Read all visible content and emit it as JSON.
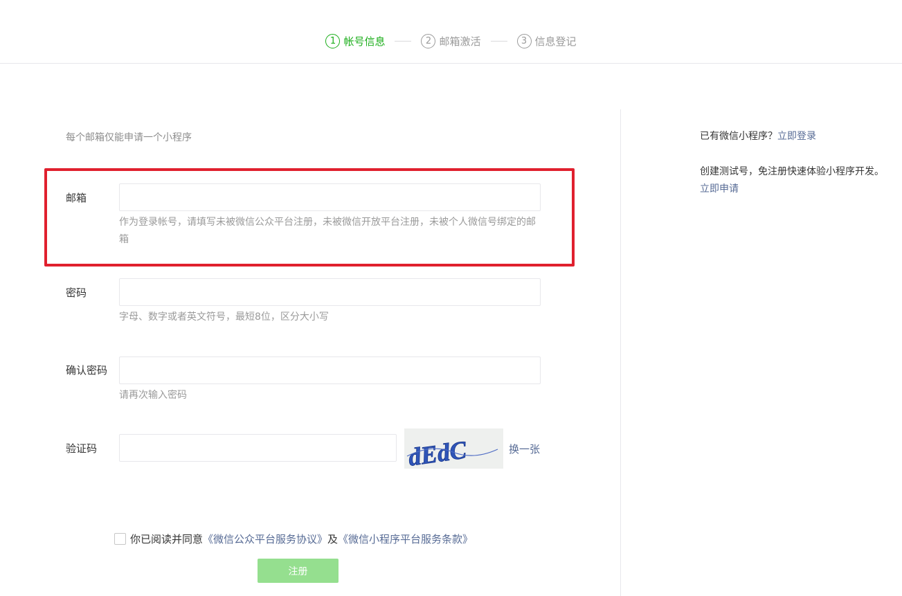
{
  "steps": [
    {
      "num": "1",
      "label": "帐号信息",
      "active": true
    },
    {
      "num": "2",
      "label": "邮箱激活",
      "active": false
    },
    {
      "num": "3",
      "label": "信息登记",
      "active": false
    }
  ],
  "form": {
    "tip": "每个邮箱仅能申请一个小程序",
    "email": {
      "label": "邮箱",
      "value": "",
      "hint": "作为登录帐号，请填写未被微信公众平台注册，未被微信开放平台注册，未被个人微信号绑定的邮箱"
    },
    "password": {
      "label": "密码",
      "value": "",
      "hint": "字母、数字或者英文符号，最短8位，区分大小写"
    },
    "confirm_password": {
      "label": "确认密码",
      "value": "",
      "hint": "请再次输入密码"
    },
    "captcha": {
      "label": "验证码",
      "value": "",
      "image_text": "dEdC",
      "change_label": "换一张"
    },
    "agreement": {
      "prefix": "你已阅读并同意",
      "link1": "《微信公众平台服务协议》",
      "middle": "及",
      "link2": "《微信小程序平台服务条款》",
      "checked": false
    },
    "submit_label": "注册"
  },
  "sidebar": {
    "login_prompt": "已有微信小程序？",
    "login_link": "立即登录",
    "test_prompt": "创建测试号，免注册快速体验小程序开发。",
    "test_link": "立即申请"
  },
  "colors": {
    "accent": "#1aad19",
    "link": "#576b95",
    "highlight": "#e0202e",
    "button_disabled": "#95df8f"
  }
}
